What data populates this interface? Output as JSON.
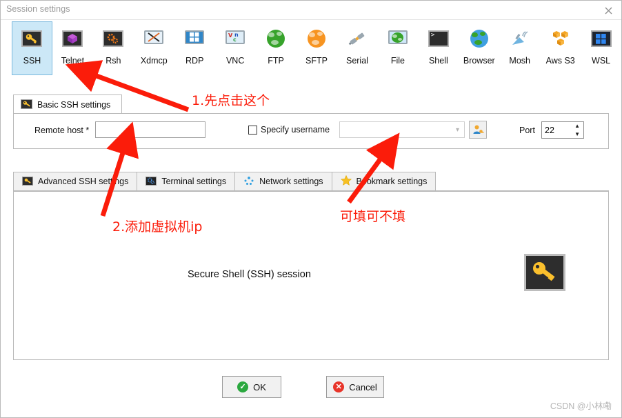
{
  "window": {
    "title": "Session settings",
    "close_icon": "close-icon"
  },
  "protocols": [
    {
      "label": "SSH",
      "icon": "key-icon",
      "selected": true
    },
    {
      "label": "Telnet",
      "icon": "cube-icon",
      "selected": false
    },
    {
      "label": "Rsh",
      "icon": "gears-icon",
      "selected": false
    },
    {
      "label": "Xdmcp",
      "icon": "x-monitor-icon",
      "selected": false
    },
    {
      "label": "RDP",
      "icon": "windows-monitor-icon",
      "selected": false
    },
    {
      "label": "VNC",
      "icon": "vnc-monitor-icon",
      "selected": false
    },
    {
      "label": "FTP",
      "icon": "green-globe-icon",
      "selected": false
    },
    {
      "label": "SFTP",
      "icon": "orange-globe-icon",
      "selected": false
    },
    {
      "label": "Serial",
      "icon": "plug-icon",
      "selected": false
    },
    {
      "label": "File",
      "icon": "file-monitor-icon",
      "selected": false
    },
    {
      "label": "Shell",
      "icon": "terminal-icon",
      "selected": false
    },
    {
      "label": "Browser",
      "icon": "blue-globe-icon",
      "selected": false
    },
    {
      "label": "Mosh",
      "icon": "satellite-icon",
      "selected": false
    },
    {
      "label": "Aws S3",
      "icon": "aws-cubes-icon",
      "selected": false
    },
    {
      "label": "WSL",
      "icon": "windows-icon",
      "selected": false
    }
  ],
  "basic_tab": {
    "label": "Basic SSH settings",
    "icon": "key-icon"
  },
  "form": {
    "remote_host_label": "Remote host *",
    "remote_host_value": "",
    "remote_host_placeholder": "",
    "specify_username_label": "Specify username",
    "specify_username_checked": false,
    "username_value": "",
    "username_caret": "chevron-down-icon",
    "user_key_button_icon": "user-key-icon",
    "port_label": "Port",
    "port_value": "22",
    "spin_up": "▲",
    "spin_down": "▼"
  },
  "sub_tabs": [
    {
      "label": "Advanced SSH settings",
      "icon": "key-icon"
    },
    {
      "label": "Terminal settings",
      "icon": "gear-icon"
    },
    {
      "label": "Network settings",
      "icon": "network-dots-icon"
    },
    {
      "label": "Bookmark settings",
      "icon": "star-icon"
    }
  ],
  "content": {
    "session_title": "Secure Shell (SSH) session",
    "big_icon": "key-icon"
  },
  "buttons": {
    "ok": "OK",
    "cancel": "Cancel",
    "ok_badge": "✓",
    "cancel_badge": "✕"
  },
  "watermark": "CSDN @小林嘞",
  "annotations": {
    "color": "#fb1c0a",
    "note1": "1.先点击这个",
    "note2": "2.添加虚拟机ip",
    "note3": "可填可不填"
  }
}
